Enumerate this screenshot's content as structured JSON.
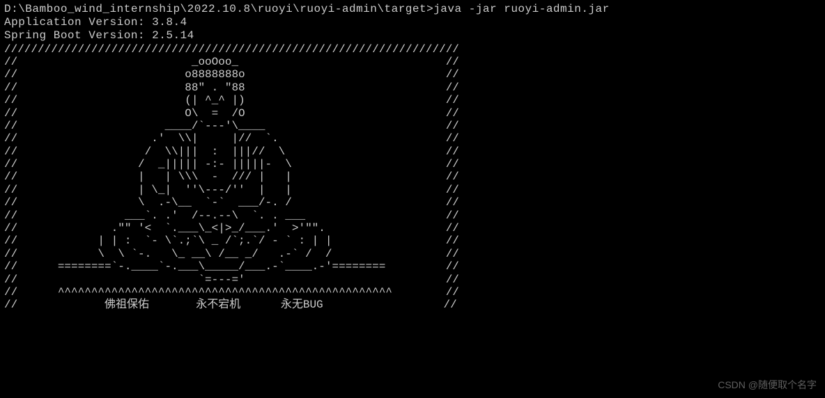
{
  "command_line": {
    "prompt": "D:\\Bamboo_wind_internship\\2022.10.8\\ruoyi\\ruoyi-admin\\target>",
    "command": "java -jar ruoyi-admin.jar"
  },
  "app_version_line": "Application Version: 3.8.4",
  "spring_boot_version_line": "Spring Boot Version: 2.5.14",
  "ascii_art": "////////////////////////////////////////////////////////////////////\n//                          _ooOoo_                               //\n//                         o8888888o                              //\n//                         88\" . \"88                              //\n//                         (| ^_^ |)                              //\n//                         O\\  =  /O                              //\n//                      ____/`---'\\____                           //\n//                    .'  \\\\|     |//  `.                         //\n//                   /  \\\\|||  :  |||//  \\                        //\n//                  /  _||||| -:- |||||-  \\                       //\n//                  |   | \\\\\\  -  /// |   |                       //\n//                  | \\_|  ''\\---/''  |   |                       //\n//                  \\  .-\\__  `-`  ___/-. /                       //\n//                ___`. .'  /--.--\\  `. . ___                     //\n//              .\"\" '<  `.___\\_<|>_/___.'  >'\"\".                  //\n//            | | :  `- \\`.;`\\ _ /`;.`/ - ` : | |                 //\n//            \\  \\ `-.   \\_ __\\ /__ _/   .-` /  /                 //\n//      ========`-.____`-.___\\_____/___.-`____.-'========         //\n//                           `=---='                              //\n//      ^^^^^^^^^^^^^^^^^^^^^^^^^^^^^^^^^^^^^^^^^^^^^^^^^^        //\n//             佛祖保佑       永不宕机      永无BUG                  //",
  "watermark": "CSDN @随便取个名字"
}
